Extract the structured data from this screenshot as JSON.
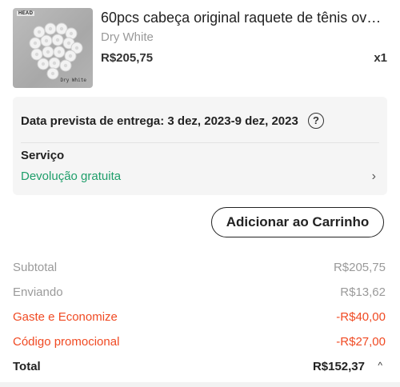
{
  "product": {
    "brand_logo": "HEAD",
    "image_caption": "Dry White",
    "title": "60pcs cabeça original raquete de tênis ov…",
    "variant": "Dry White",
    "price": "R$205,75",
    "quantity": "x1"
  },
  "delivery": {
    "text": "Data prevista de entrega: 3 dez, 2023-9 dez, 2023",
    "help_icon": "?"
  },
  "service": {
    "label": "Serviço",
    "value": "Devolução gratuita",
    "chevron": "›"
  },
  "add_to_cart_label": "Adicionar ao Carrinho",
  "summary": {
    "subtotal": {
      "label": "Subtotal",
      "value": "R$205,75"
    },
    "shipping": {
      "label": "Enviando",
      "value": "R$13,62"
    },
    "spend_save": {
      "label": "Gaste e Economize",
      "value": "-R$40,00"
    },
    "promo": {
      "label": "Código promocional",
      "value": "-R$27,00"
    },
    "total": {
      "label": "Total",
      "value": "R$152,37",
      "caret": "^"
    }
  },
  "colors": {
    "accent_green": "#1e9e6a",
    "discount_red": "#f04a23",
    "muted_gray": "#9a9a9a"
  }
}
